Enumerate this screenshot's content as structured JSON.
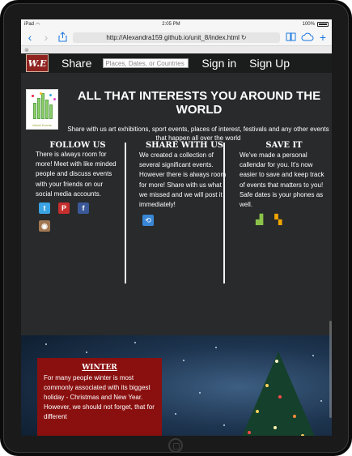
{
  "status": {
    "carrier": "iPad",
    "time": "2:05 PM",
    "battery": "100%"
  },
  "browser": {
    "url": "http://Alexandra159.github.io/unit_8/index.html"
  },
  "nav": {
    "logo_text": "W.E",
    "share": "Share",
    "search_placeholder": "Places, Dates, or Countries",
    "sign_in": "Sign in",
    "sign_up": "Sign Up"
  },
  "hero": {
    "logo_caption": "World Events",
    "title": "ALL THAT INTERESTS YOU AROUND THE WORLD",
    "subtitle": "Share with us art exhibitions, sport events, places of interest, festivals and any other events that happen all over the world"
  },
  "columns": {
    "follow": {
      "title": "FOLLOW US",
      "text": "There is always room for more! Meet with like minded people and discuss events with your friends on our social media accounts.",
      "icons": [
        "twitter-icon",
        "pinterest-icon",
        "facebook-icon",
        "instagram-icon"
      ]
    },
    "share": {
      "title": "SHARE WITH US",
      "text": "We created a collection of several significant events. However there is always room for more! Share with us what we missed and we will post it immediately!",
      "icon": "share-icon"
    },
    "save": {
      "title": "SAVE IT",
      "text": "We've made a personal callendar for you. It's now easier to save and keep track of events that matters to you! Safe dates is your phones as well.",
      "icons": [
        "apple-icon",
        "android-icon",
        "windows-icon"
      ]
    }
  },
  "winter": {
    "title": "WINTER",
    "text": "For many people winter is most commonly associated with its biggest holiday - Christmas and New Year. However, we should not forget, that for different"
  },
  "colors": {
    "page_bg": "#282a2b",
    "nav_bg": "#1b1c1c",
    "winter_box": "#8a0f0f",
    "link_blue": "#1a78e0"
  }
}
